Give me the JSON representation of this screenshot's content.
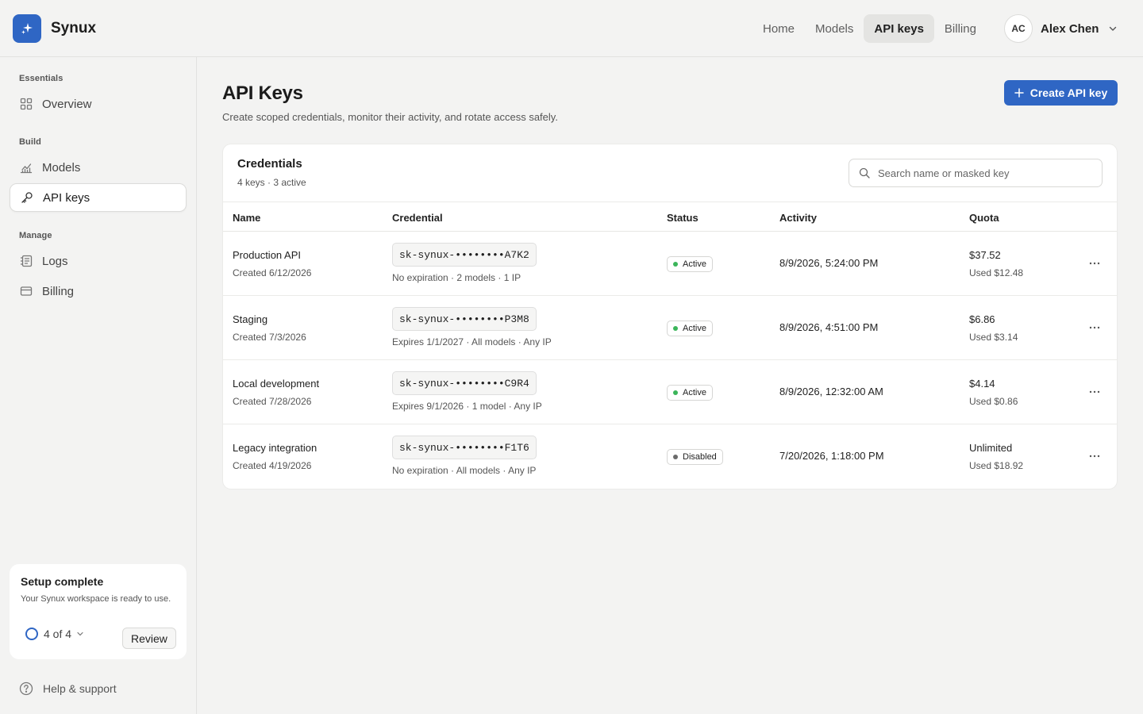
{
  "brand": {
    "name": "Synux",
    "logo_icon": "sparkle-icon",
    "accent_color": "#2f66c4"
  },
  "nav": {
    "items": [
      {
        "label": "Home"
      },
      {
        "label": "Models"
      },
      {
        "label": "API keys",
        "active": true
      },
      {
        "label": "Billing"
      }
    ]
  },
  "user": {
    "initials": "AC",
    "name": "Alex Chen"
  },
  "sidebar": {
    "sections": [
      {
        "label": "Essentials"
      },
      {
        "label": "Build"
      },
      {
        "label": "Manage"
      }
    ],
    "items": [
      {
        "label": "Overview",
        "icon": "grid-icon"
      },
      {
        "label": "Models",
        "icon": "chart-icon"
      },
      {
        "label": "API keys",
        "icon": "key-icon",
        "active": true
      },
      {
        "label": "Logs",
        "icon": "logs-icon"
      },
      {
        "label": "Billing",
        "icon": "card-icon"
      }
    ],
    "setup": {
      "title": "Setup complete",
      "description": "Your Synux workspace is ready to use.",
      "progress": "4 of 4",
      "review_label": "Review"
    },
    "help_label": "Help & support"
  },
  "page": {
    "title": "API Keys",
    "subtitle": "Create scoped credentials, monitor their activity, and rotate access safely.",
    "create_label": "Create API key"
  },
  "credentials": {
    "title": "Credentials",
    "meta": "4 keys · 3 active",
    "search_placeholder": "Search name or masked key",
    "columns": [
      "Name",
      "Credential",
      "Status",
      "Activity",
      "Quota"
    ],
    "rows": [
      {
        "name": "Production API",
        "created": "Created 6/12/2026",
        "key": "sk-synux-••••••••A7K2",
        "key_meta": "No expiration · 2 models · 1 IP",
        "status": "Active",
        "activity": "8/9/2026, 5:24:00 PM",
        "quota": "$37.52",
        "used": "Used $12.48"
      },
      {
        "name": "Staging",
        "created": "Created 7/3/2026",
        "key": "sk-synux-••••••••P3M8",
        "key_meta": "Expires 1/1/2027 · All models · Any IP",
        "status": "Active",
        "activity": "8/9/2026, 4:51:00 PM",
        "quota": "$6.86",
        "used": "Used $3.14"
      },
      {
        "name": "Local development",
        "created": "Created 7/28/2026",
        "key": "sk-synux-••••••••C9R4",
        "key_meta": "Expires 9/1/2026 · 1 model · Any IP",
        "status": "Active",
        "activity": "8/9/2026, 12:32:00 AM",
        "quota": "$4.14",
        "used": "Used $0.86"
      },
      {
        "name": "Legacy integration",
        "created": "Created 4/19/2026",
        "key": "sk-synux-••••••••F1T6",
        "key_meta": "No expiration · All models · Any IP",
        "status": "Disabled",
        "activity": "7/20/2026, 1:18:00 PM",
        "quota": "Unlimited",
        "used": "Used $18.92"
      }
    ],
    "status_colors": {
      "Active": "#3bb55a",
      "Disabled": "#6b6b6b"
    }
  }
}
